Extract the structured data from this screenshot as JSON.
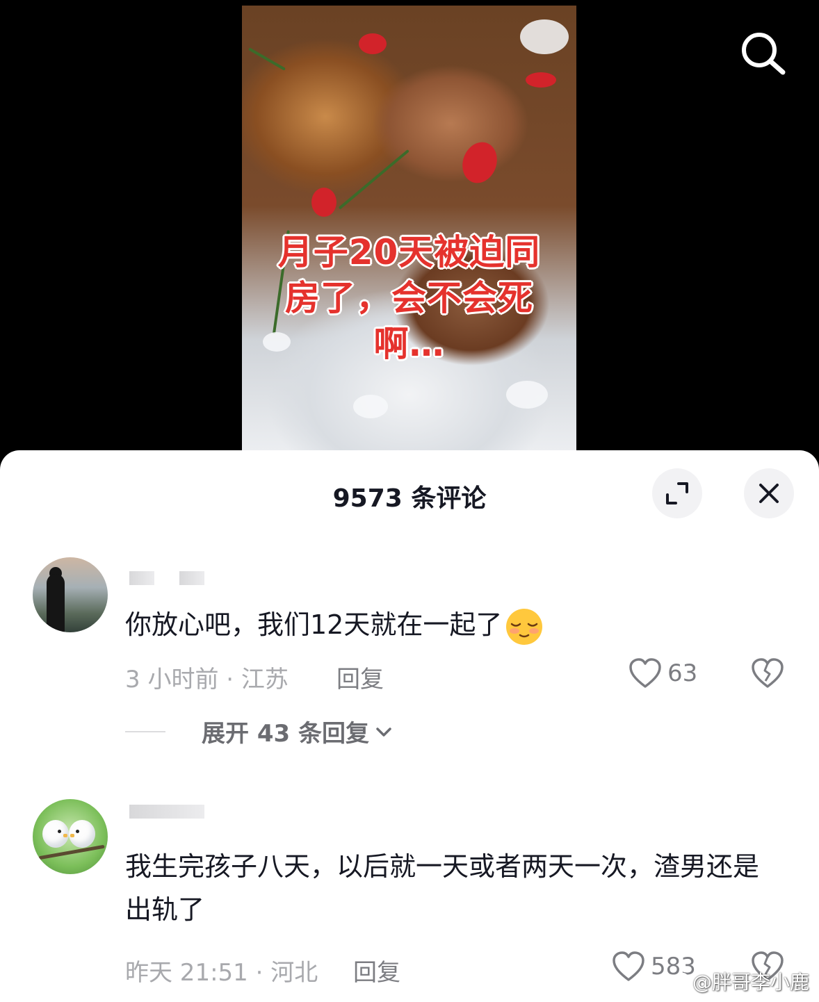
{
  "video": {
    "overlay_lines": [
      "月子20天被迫同",
      "房了，会不会死",
      "啊…"
    ]
  },
  "header": {
    "comment_count_title": "9573 条评论",
    "icons": [
      "search-icon",
      "expand-icon",
      "close-icon"
    ]
  },
  "comments": [
    {
      "text": "你放心吧，我们12天就在一起了",
      "emoji": "shy-smile-emoji",
      "meta": "3 小时前 · 江苏",
      "reply_label": "回复",
      "likes": "63",
      "expand_replies": "展开 43 条回复"
    },
    {
      "text": "我生完孩子八天，以后就一天或者两天一次，渣男还是出轨了",
      "meta": "昨天 21:51 · 河北",
      "reply_label": "回复",
      "likes": "583"
    }
  ],
  "watermark": "@胖哥李小鹿",
  "colors": {
    "overlay_text": "#e5322d",
    "sheet_bg": "#ffffff",
    "meta_gray": "#a8a9ad"
  }
}
